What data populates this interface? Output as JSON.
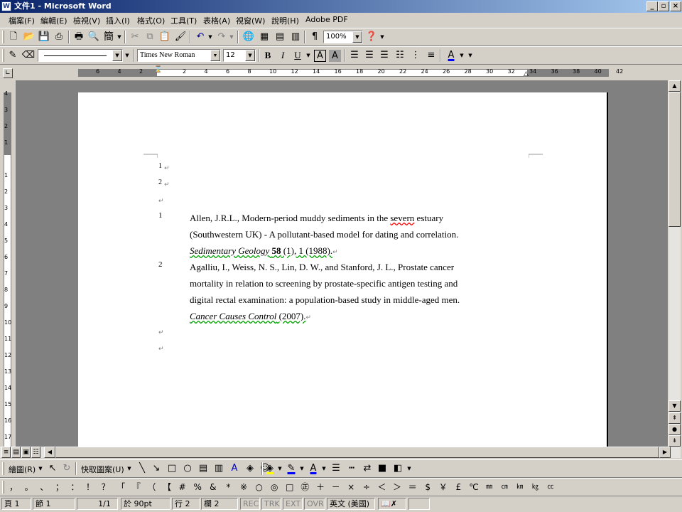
{
  "window": {
    "title": "文件1 - Microsoft Word",
    "app_icon": "W"
  },
  "menu": [
    "檔案(F)",
    "編輯(E)",
    "檢視(V)",
    "插入(I)",
    "格式(O)",
    "工具(T)",
    "表格(A)",
    "視窗(W)",
    "說明(H)",
    "Adobe PDF"
  ],
  "standard_toolbar": {
    "zoom": "100%",
    "chinese_btn": "簡"
  },
  "format_toolbar": {
    "font": "Times New Roman",
    "size": "12",
    "bold": "B",
    "italic": "I",
    "underline": "U"
  },
  "ruler_numbers": [
    "6",
    "4",
    "2",
    "",
    "2",
    "4",
    "6",
    "8",
    "10",
    "12",
    "14",
    "16",
    "18",
    "20",
    "22",
    "24",
    "26",
    "28",
    "30",
    "32",
    "34",
    "36",
    "38",
    "40",
    "42"
  ],
  "vruler_numbers": [
    "4",
    "3",
    "2",
    "1",
    "",
    "1",
    "2",
    "3",
    "4",
    "5",
    "6",
    "7",
    "8",
    "9",
    "10",
    "11",
    "12",
    "13",
    "14",
    "15",
    "16",
    "17"
  ],
  "document": {
    "footnote_marks": [
      "1",
      "2"
    ],
    "references": [
      {
        "num": "1",
        "line1_pre": "Allen, J.R.L., Modern-period muddy sediments in the ",
        "line1_err": "severn",
        "line1_post": " estuary",
        "line2": "(Southwestern UK) - A pollutant-based model for dating and correlation.",
        "journal": "Sedimentary Geology",
        "volume": "58",
        "rest": " (1), 1 (1988)."
      },
      {
        "num": "2",
        "line1": "Agalliu, I., Weiss, N. S., Lin, D. W., and Stanford, J. L., Prostate cancer",
        "line2": "mortality in relation to screening by prostate-specific antigen testing and",
        "line3": "digital rectal examination: a population-based study in middle-aged men.",
        "journal": "Cancer Causes Control",
        "rest": " (2007)."
      }
    ]
  },
  "drawing_toolbar": {
    "draw_label": "繪圖(R)",
    "autoshapes_label": "快取圖案(U)"
  },
  "symbol_bar": [
    "，",
    "。",
    "、",
    "；",
    "：",
    "！",
    "？",
    "「",
    "『",
    "（",
    "【",
    "#",
    "%",
    "&",
    "*",
    "※",
    "○",
    "◎",
    "□",
    "㊣",
    "＋",
    "－",
    "×",
    "÷",
    "＜",
    "＞",
    "＝",
    "$",
    "￥",
    "£",
    "℃",
    "㎜",
    "㎝",
    "㎞",
    "㎏",
    "㏄"
  ],
  "status": {
    "page": "頁 1",
    "section": "節 1",
    "pages": "1/1",
    "at": "於 90pt",
    "line": "行 2",
    "col": "欄 2",
    "rec": "REC",
    "trk": "TRK",
    "ext": "EXT",
    "ovr": "OVR",
    "lang": "英文 (美國)"
  }
}
